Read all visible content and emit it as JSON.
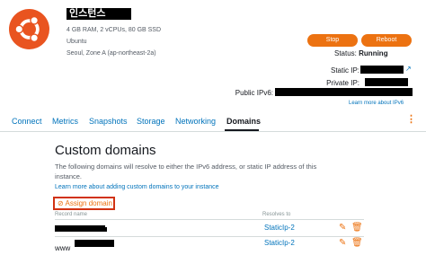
{
  "instance": {
    "name": "인스턴스",
    "specs": "4 GB RAM, 2 vCPUs, 80 GB SSD",
    "os": "Ubuntu",
    "zone": "Seoul, Zone A (ap-northeast-2a)"
  },
  "actions": {
    "stop_label": "Stop",
    "reboot_label": "Reboot"
  },
  "status": {
    "label": "Status:",
    "value": "Running"
  },
  "network": {
    "static_ip_label": "Static IP:",
    "private_ip_label": "Private IP:",
    "public_ipv6_label": "Public IPv6:",
    "learn_ipv6": "Learn more about IPv6"
  },
  "tabs": [
    {
      "label": "Connect"
    },
    {
      "label": "Metrics"
    },
    {
      "label": "Snapshots"
    },
    {
      "label": "Storage"
    },
    {
      "label": "Networking"
    },
    {
      "label": "Domains"
    }
  ],
  "domains": {
    "title": "Custom domains",
    "description": "The following domains will resolve to either the IPv6 address, or static IP address of this instance.",
    "learn_link": "Learn more about adding custom domains to your instance",
    "assign_label": "Assign domain",
    "columns": {
      "record": "Record name",
      "resolves": "Resolves to"
    },
    "rows": [
      {
        "record_prefix": "",
        "resolves_to": "StaticIp-2"
      },
      {
        "record_prefix": "www",
        "resolves_to": "StaticIp-2"
      }
    ]
  },
  "colors": {
    "accent": "#ec7211",
    "link": "#0073bb",
    "highlight": "#d13212"
  },
  "icons": {
    "logo": "ubuntu-logo",
    "edit": "edit-icon",
    "delete": "trash-icon",
    "kebab": "more-options-icon"
  }
}
